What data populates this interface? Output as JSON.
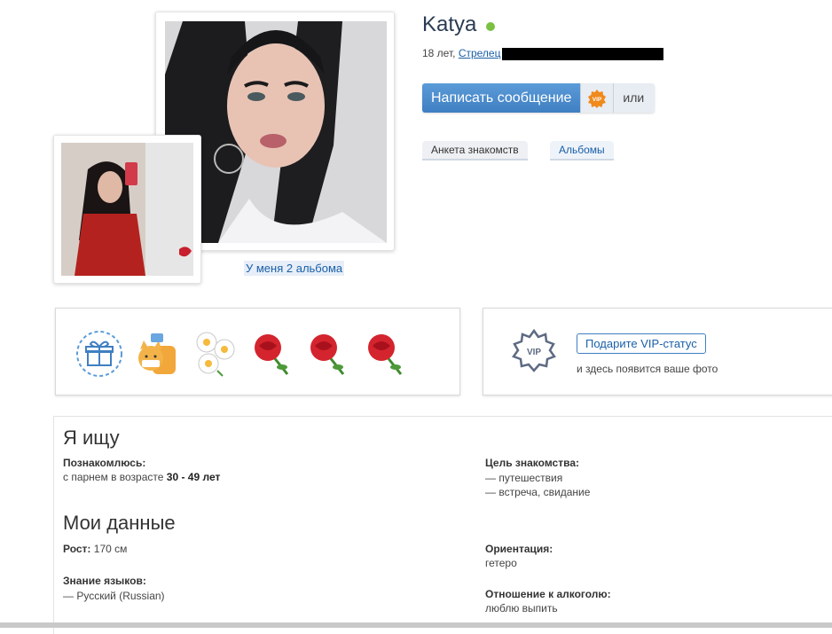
{
  "profile": {
    "name": "Katya",
    "age": "18 лет,",
    "zodiac": "Стрелец",
    "albums_link": "У меня 2 альбома"
  },
  "actions": {
    "message_button": "Написать сообщение",
    "vip_icon_text": "VIP",
    "or_label": "или"
  },
  "tabs": [
    {
      "label": "Анкета знакомств",
      "active": true
    },
    {
      "label": "Альбомы",
      "active": false
    }
  ],
  "gifts": [
    "gift-box-icon",
    "cat-backpack-icon",
    "daisies-icon",
    "rose-icon",
    "rose-icon",
    "rose-icon"
  ],
  "vip": {
    "star_text": "VIP",
    "button": "Подарите VIP-статус",
    "note": "и здесь появится ваше фото"
  },
  "seeking": {
    "title": "Я ищу",
    "meet_label": "Познакомлюсь:",
    "meet_prefix": "с парнем в возрасте ",
    "age_range": "30 - 49 лет",
    "goal_label": "Цель знакомства:",
    "goals": [
      "— путешествия",
      "— встреча, свидание"
    ]
  },
  "my_data": {
    "title": "Мои данные",
    "height_label": "Рост:",
    "height_value": "170 см",
    "languages_label": "Знание языков:",
    "languages": [
      "— Русский (Russian)"
    ],
    "orientation_label": "Ориентация:",
    "orientation_value": "гетеро",
    "alcohol_label": "Отношение к алкоголю:",
    "alcohol_value": "люблю выпить"
  },
  "colors": {
    "online": "#7ac142",
    "primary": "#3f7fc2",
    "link": "#1a5fa8"
  }
}
